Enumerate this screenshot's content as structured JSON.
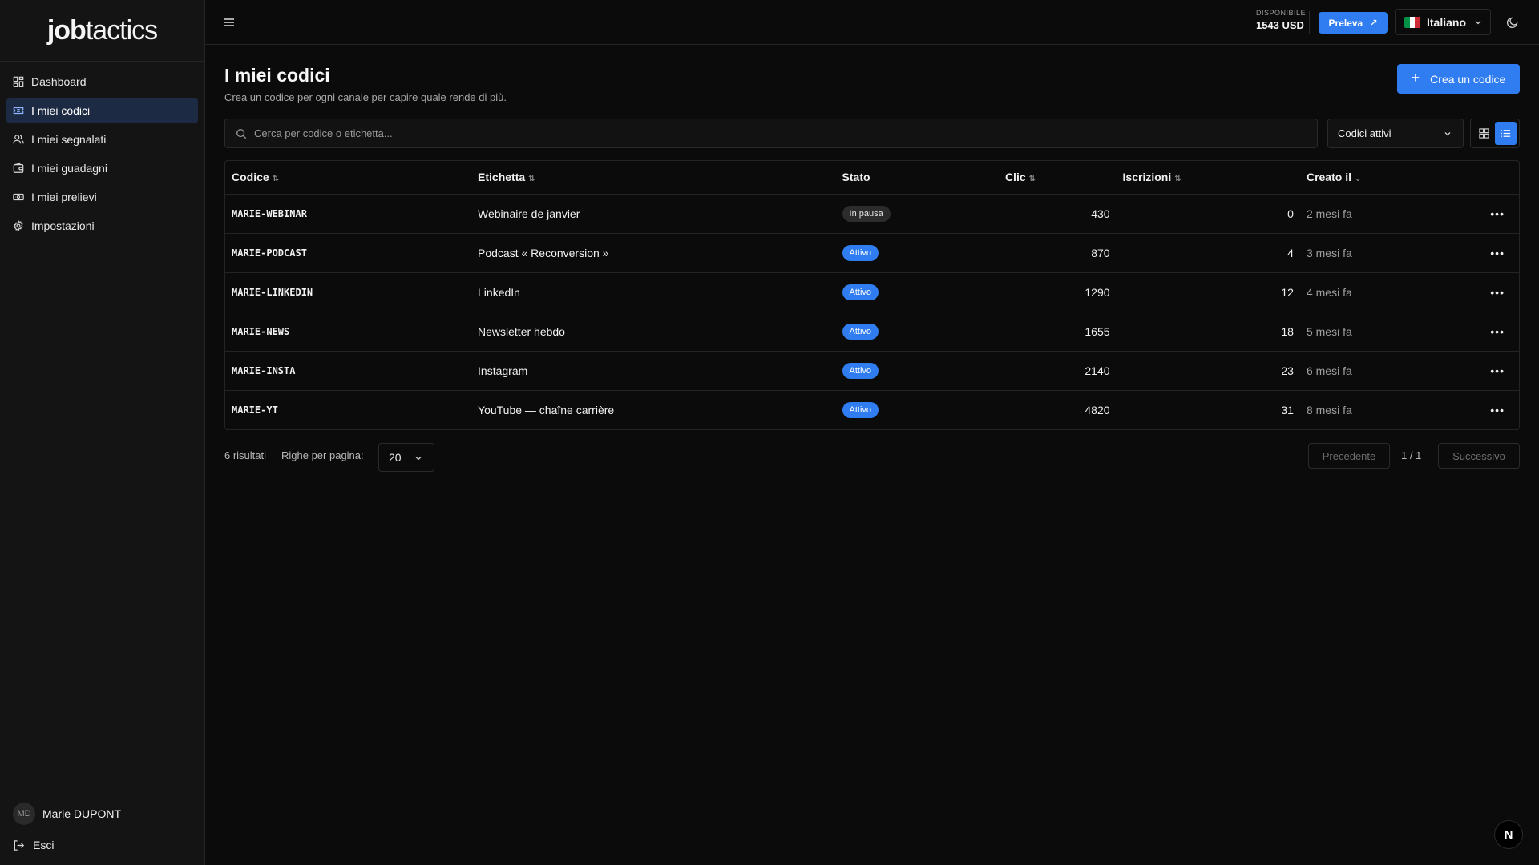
{
  "brand": {
    "logo_bold": "job",
    "logo_light": "tactics"
  },
  "sidebar": {
    "items": [
      {
        "label": "Dashboard",
        "icon": "dashboard-icon"
      },
      {
        "label": "I miei codici",
        "icon": "ticket-icon",
        "active": true
      },
      {
        "label": "I miei segnalati",
        "icon": "users-icon"
      },
      {
        "label": "I miei guadagni",
        "icon": "wallet-icon"
      },
      {
        "label": "I miei prelievi",
        "icon": "banknote-icon"
      },
      {
        "label": "Impostazioni",
        "icon": "gear-icon"
      }
    ],
    "user": {
      "initials": "MD",
      "name": "Marie DUPONT"
    },
    "logout_label": "Esci"
  },
  "topbar": {
    "balance_label": "DISPONIBILE",
    "balance_value": "1543 USD",
    "withdraw_label": "Preleva",
    "language": "Italiano"
  },
  "page": {
    "title": "I miei codici",
    "subtitle": "Crea un codice per ogni canale per capire quale rende di più.",
    "create_label": "Crea un codice",
    "search_placeholder": "Cerca per codice o etichetta...",
    "filter_value": "Codici attivi"
  },
  "table": {
    "headers": {
      "code": "Codice",
      "label": "Etichetta",
      "status": "Stato",
      "clicks": "Clic",
      "signups": "Iscrizioni",
      "created": "Creato il"
    },
    "rows": [
      {
        "code": "MARIE-WEBINAR",
        "label": "Webinaire de janvier",
        "status": "In pausa",
        "clicks": "430",
        "signups": "0",
        "created": "2 mesi fa"
      },
      {
        "code": "MARIE-PODCAST",
        "label": "Podcast « Reconversion »",
        "status": "Attivo",
        "clicks": "870",
        "signups": "4",
        "created": "3 mesi fa"
      },
      {
        "code": "MARIE-LINKEDIN",
        "label": "LinkedIn",
        "status": "Attivo",
        "clicks": "1290",
        "signups": "12",
        "created": "4 mesi fa"
      },
      {
        "code": "MARIE-NEWS",
        "label": "Newsletter hebdo",
        "status": "Attivo",
        "clicks": "1655",
        "signups": "18",
        "created": "5 mesi fa"
      },
      {
        "code": "MARIE-INSTA",
        "label": "Instagram",
        "status": "Attivo",
        "clicks": "2140",
        "signups": "23",
        "created": "6 mesi fa"
      },
      {
        "code": "MARIE-YT",
        "label": "YouTube — chaîne carrière",
        "status": "Attivo",
        "clicks": "4820",
        "signups": "31",
        "created": "8 mesi fa"
      }
    ]
  },
  "footer": {
    "results": "6 risultati",
    "rows_per_page_label": "Righe per pagina:",
    "rows_per_page": "20",
    "prev": "Precedente",
    "page_info": "1 / 1",
    "next": "Successivo"
  },
  "fab_label": "N",
  "colors": {
    "accent": "#2f7df0",
    "background": "#0b0b0b",
    "sidebar": "#141414",
    "active_nav": "#1d2a44"
  }
}
